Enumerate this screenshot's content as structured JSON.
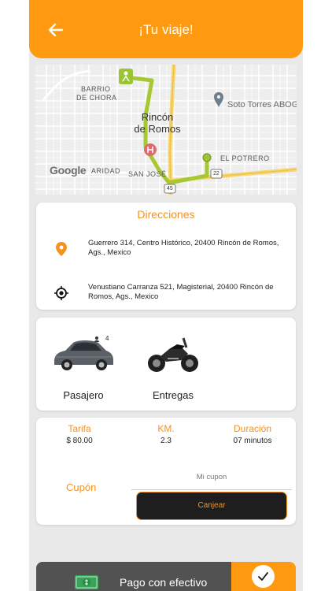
{
  "header": {
    "title": "¡Tu viaje!"
  },
  "map": {
    "labels": {
      "barrio": "BARRIO",
      "de_chora": "DE CHORA",
      "town_line1": "Rincón",
      "town_line2": "de Romos",
      "place": "Soto Torres ABOG",
      "el_potrero": "EL POTRERO",
      "san_jose": "SAN JOSÉ",
      "aridad": "ARIDAD",
      "highway_45": "45",
      "highway_22": "22"
    },
    "attribution": "Google",
    "route_color": "#a6c832"
  },
  "directions": {
    "title": "Direcciones",
    "origin": "Guerrero 314, Centro Histórico, 20400 Rincón de Romos, Ags., Mexico",
    "destination": "Venustiano Carranza 521, Magisterial, 20400 Rincón de Romos, Ags., Mexico"
  },
  "vehicles": [
    {
      "label": "Pasajero",
      "icon": "car-icon",
      "badge": "4"
    },
    {
      "label": "Entregas",
      "icon": "motorcycle-icon"
    }
  ],
  "fare": {
    "tarifa_label": "Tarifa",
    "tarifa_value": "$ 80.00",
    "km_label": "KM.",
    "km_value": "2.3",
    "duracion_label": "Duración",
    "duracion_value": "07 minutos",
    "cupon_label": "Cupón",
    "cupon_placeholder": "Mi cupon",
    "canjear_label": "Canjear"
  },
  "payment": {
    "label": "Pago con efectivo",
    "icon": "cash-icon",
    "selected_icon": "check-icon"
  },
  "colors": {
    "accent": "#ff9a10",
    "accent_text": "#f39321",
    "dark": "#1e1e1e",
    "pay_bar": "#525252"
  }
}
